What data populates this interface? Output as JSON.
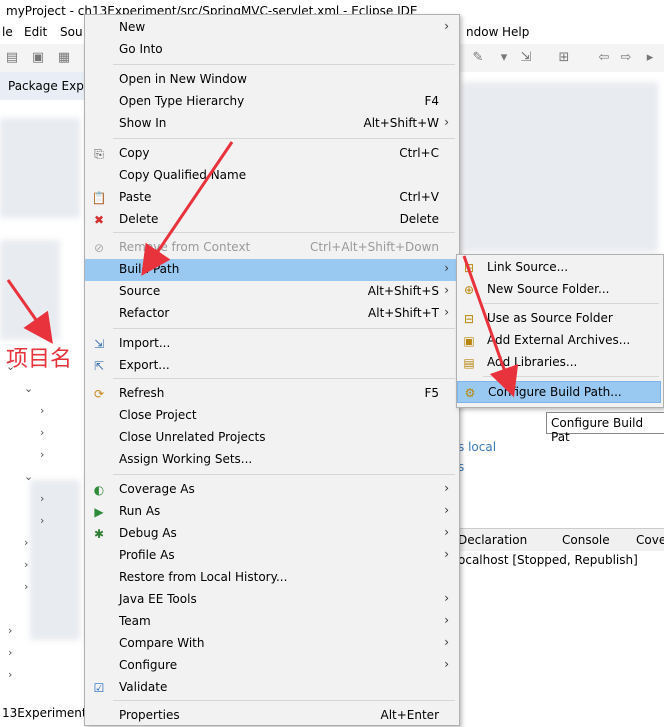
{
  "window": {
    "title": "myProject - ch13Experiment/src/SpringMVC-servlet.xml - Eclipse IDE"
  },
  "menubar": {
    "items": [
      "le",
      "Edit",
      "Sou",
      "ndow",
      "Help"
    ]
  },
  "package_explorer": {
    "tab_label": "Package Exp"
  },
  "annotation": {
    "label": "项目名"
  },
  "context_menu": {
    "items": [
      {
        "label": "New",
        "shortcut": "",
        "submenu": true,
        "icon": ""
      },
      {
        "label": "Go Into",
        "shortcut": "",
        "submenu": false,
        "icon": ""
      },
      {
        "label": "Open in New Window",
        "shortcut": "",
        "submenu": false,
        "icon": ""
      },
      {
        "label": "Open Type Hierarchy",
        "shortcut": "F4",
        "submenu": false,
        "icon": ""
      },
      {
        "label": "Show In",
        "shortcut": "Alt+Shift+W",
        "submenu": true,
        "icon": ""
      },
      {
        "label": "Copy",
        "shortcut": "Ctrl+C",
        "submenu": false,
        "icon": "copy-icon"
      },
      {
        "label": "Copy Qualified Name",
        "shortcut": "",
        "submenu": false,
        "icon": ""
      },
      {
        "label": "Paste",
        "shortcut": "Ctrl+V",
        "submenu": false,
        "icon": "paste-icon"
      },
      {
        "label": "Delete",
        "shortcut": "Delete",
        "submenu": false,
        "icon": "delete-icon"
      },
      {
        "label": "Remove from Context",
        "shortcut": "Ctrl+Alt+Shift+Down",
        "submenu": false,
        "icon": "remove-context-icon",
        "disabled": true
      },
      {
        "label": "Build Path",
        "shortcut": "",
        "submenu": true,
        "icon": "",
        "highlighted": true
      },
      {
        "label": "Source",
        "shortcut": "Alt+Shift+S",
        "submenu": true,
        "icon": ""
      },
      {
        "label": "Refactor",
        "shortcut": "Alt+Shift+T",
        "submenu": true,
        "icon": ""
      },
      {
        "label": "Import...",
        "shortcut": "",
        "submenu": false,
        "icon": "import-icon"
      },
      {
        "label": "Export...",
        "shortcut": "",
        "submenu": false,
        "icon": "export-icon"
      },
      {
        "label": "Refresh",
        "shortcut": "F5",
        "submenu": false,
        "icon": "refresh-icon"
      },
      {
        "label": "Close Project",
        "shortcut": "",
        "submenu": false,
        "icon": ""
      },
      {
        "label": "Close Unrelated Projects",
        "shortcut": "",
        "submenu": false,
        "icon": ""
      },
      {
        "label": "Assign Working Sets...",
        "shortcut": "",
        "submenu": false,
        "icon": ""
      },
      {
        "label": "Coverage As",
        "shortcut": "",
        "submenu": true,
        "icon": "coverage-icon"
      },
      {
        "label": "Run As",
        "shortcut": "",
        "submenu": true,
        "icon": "run-icon"
      },
      {
        "label": "Debug As",
        "shortcut": "",
        "submenu": true,
        "icon": "debug-icon"
      },
      {
        "label": "Profile As",
        "shortcut": "",
        "submenu": true,
        "icon": ""
      },
      {
        "label": "Restore from Local History...",
        "shortcut": "",
        "submenu": false,
        "icon": ""
      },
      {
        "label": "Java EE Tools",
        "shortcut": "",
        "submenu": true,
        "icon": ""
      },
      {
        "label": "Team",
        "shortcut": "",
        "submenu": true,
        "icon": ""
      },
      {
        "label": "Compare With",
        "shortcut": "",
        "submenu": true,
        "icon": ""
      },
      {
        "label": "Configure",
        "shortcut": "",
        "submenu": true,
        "icon": ""
      },
      {
        "label": "Validate",
        "shortcut": "",
        "submenu": false,
        "icon": "checkbox-checked-icon"
      },
      {
        "label": "Properties",
        "shortcut": "Alt+Enter",
        "submenu": false,
        "icon": ""
      }
    ]
  },
  "build_path_submenu": {
    "items": [
      {
        "label": "Link Source...",
        "icon": "link-source-icon"
      },
      {
        "label": "New Source Folder...",
        "icon": "new-source-folder-icon"
      },
      {
        "label": "Use as Source Folder",
        "icon": "use-source-folder-icon"
      },
      {
        "label": "Add External Archives...",
        "icon": "external-archive-icon"
      },
      {
        "label": "Add Libraries...",
        "icon": "add-libraries-icon"
      },
      {
        "label": "Configure Build Path...",
        "icon": "configure-build-path-icon",
        "highlighted": true
      }
    ]
  },
  "tooltip": {
    "text": "Configure Build Pat"
  },
  "editor_fragments": {
    "line1": "s local",
    "line2": "s"
  },
  "bottom_panel": {
    "tabs": [
      "Declaration",
      "Console",
      "Cove"
    ]
  },
  "server_status": {
    "text": "ocalhost  [Stopped, Republish]"
  },
  "status_bar": {
    "text": "13Experiment"
  },
  "colors": {
    "highlight": "#99c9f0",
    "menu_bg": "#f2f2f2",
    "annotation_red": "#e8323c"
  }
}
